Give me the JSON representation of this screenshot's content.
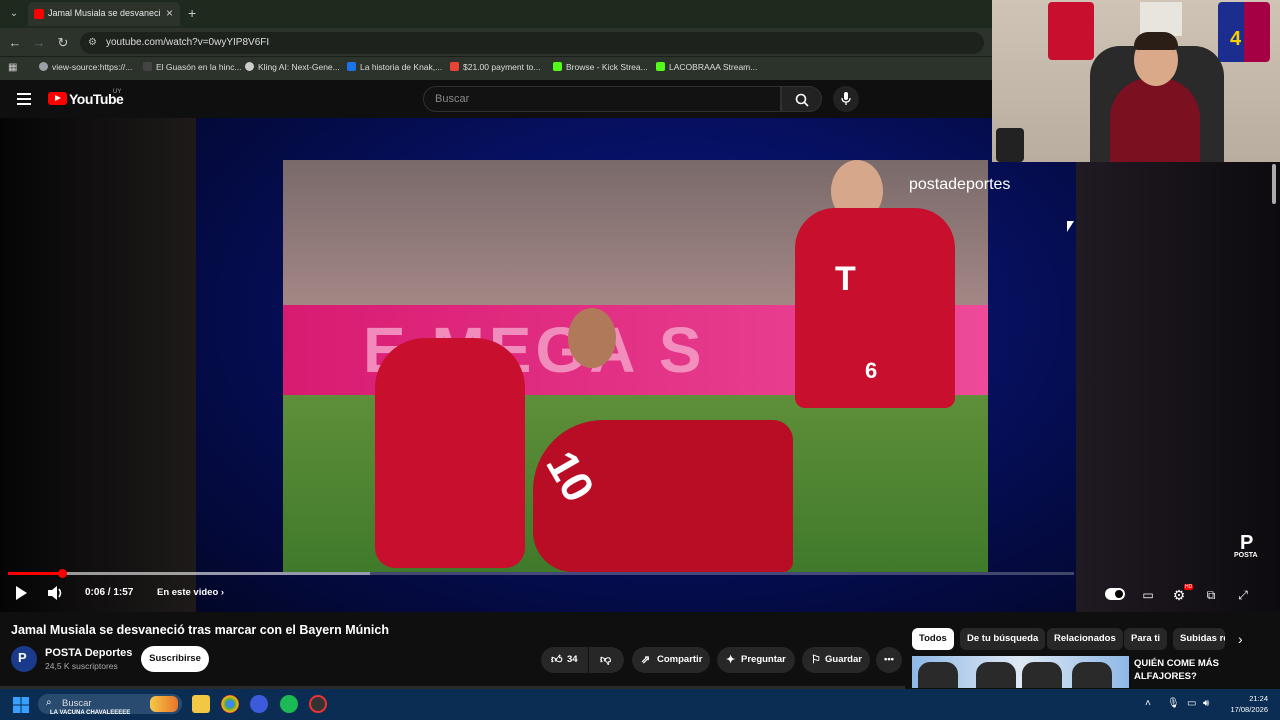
{
  "browser": {
    "tab_title": "Jamal Musiala se desvaneció tras marcar con el Bayern Múnich - YouTube",
    "new_tab_symbol": "+",
    "close_symbol": "×",
    "url": "youtube.com/watch?v=0wyYIP8V6FI",
    "bookmarks": [
      {
        "label": "view-source:https://...",
        "color": "#9aa0a6"
      },
      {
        "label": "El Guasón en la hinc...",
        "color": "#444444"
      },
      {
        "label": "Kling AI: Next-Gene...",
        "color": "#cccccc"
      },
      {
        "label": "La historia de Knak,...",
        "color": "#1a73e8"
      },
      {
        "label": "$21.00 payment to...",
        "color": "#ea4335"
      },
      {
        "label": "Browse - Kick Strea...",
        "color": "#53fc18"
      },
      {
        "label": "LACOBRAAA Stream...",
        "color": "#53fc18"
      }
    ]
  },
  "youtube": {
    "logo_text": "YouTube",
    "country_code": "UY",
    "search_placeholder": "Buscar"
  },
  "webcam": {
    "shirt_number": "4"
  },
  "video": {
    "watermark": "postadeportes",
    "channel_logo_text": "POSTA",
    "jersey_number_left": "10",
    "jersey_number_right": "6",
    "time": "0:06 / 1:57",
    "chapters_label": "En este video",
    "progress": 0.051,
    "buffered": 0.34
  },
  "meta": {
    "title": "Jamal Musiala se desvaneció tras marcar con el Bayern Múnich",
    "channel": "POSTA Deportes",
    "subscribers": "24,5 K suscriptores",
    "subscribe_label": "Suscribirse",
    "likes": "34",
    "share_label": "Compartir",
    "ask_label": "Preguntar",
    "save_label": "Guardar"
  },
  "sidebar": {
    "chips": [
      "Todos",
      "De tu búsqueda",
      "Relacionados",
      "Para ti",
      "Subidas re"
    ],
    "rec_title": "QUIÉN COME MÁS ALFAJORES?"
  },
  "taskbar": {
    "search_placeholder": "Buscar",
    "banner": "LA VACUNA CHAVALEEEEE",
    "time": "21:24",
    "date": "17/08/2026"
  }
}
